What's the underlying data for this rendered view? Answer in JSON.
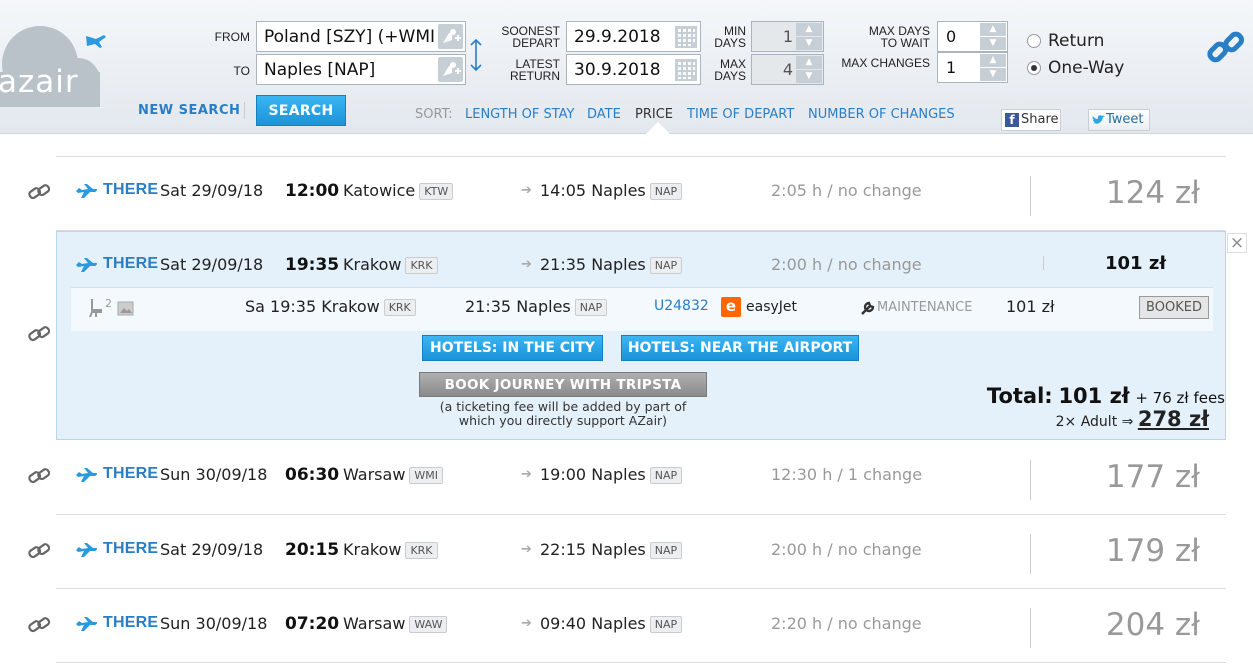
{
  "logo": {
    "text": "azair"
  },
  "search": {
    "from_label": "FROM",
    "to_label": "TO",
    "from_value": "Poland [SZY] (+WMI",
    "to_value": "Naples [NAP]",
    "soonest_depart_label_1": "SOONEST",
    "soonest_depart_label_2": "DEPART",
    "latest_return_label_1": "LATEST",
    "latest_return_label_2": "RETURN",
    "soonest_depart_value": "29.9.2018",
    "latest_return_value": "30.9.2018",
    "min_days_label_1": "MIN",
    "min_days_label_2": "DAYS",
    "max_days_label_1": "MAX",
    "max_days_label_2": "DAYS",
    "min_days_value": "1",
    "max_days_value": "4",
    "max_days_wait_label_1": "MAX DAYS",
    "max_days_wait_label_2": "TO WAIT",
    "max_changes_label": "MAX CHANGES",
    "max_days_wait_value": "0",
    "max_changes_value": "1",
    "return_label": "Return",
    "oneway_label": "One-Way",
    "new_search": "NEW SEARCH",
    "search_button": "SEARCH"
  },
  "sort": {
    "label": "SORT:",
    "items": [
      "LENGTH OF STAY",
      "DATE",
      "PRICE",
      "TIME OF DEPART",
      "NUMBER OF CHANGES"
    ],
    "active": "PRICE"
  },
  "social": {
    "share": "Share",
    "tweet": "Tweet"
  },
  "results": [
    {
      "dir": "THERE",
      "date": "Sat 29/09/18",
      "time": "12:00",
      "city": "Katowice",
      "code": "KTW",
      "arr_time": "14:05",
      "arr_city": "Naples",
      "arr_code": "NAP",
      "duration": "2:05 h / no change",
      "price": "124 zł"
    },
    {
      "dir": "THERE",
      "date": "Sat 29/09/18",
      "time": "19:35",
      "city": "Krakow",
      "code": "KRK",
      "arr_time": "21:35",
      "arr_city": "Naples",
      "arr_code": "NAP",
      "duration": "2:00 h / no change",
      "price": "101 zł"
    },
    {
      "dir": "THERE",
      "date": "Sun 30/09/18",
      "time": "06:30",
      "city": "Warsaw",
      "code": "WMI",
      "arr_time": "19:00",
      "arr_city": "Naples",
      "arr_code": "NAP",
      "duration": "12:30 h / 1 change",
      "price": "177 zł"
    },
    {
      "dir": "THERE",
      "date": "Sat 29/09/18",
      "time": "20:15",
      "city": "Krakow",
      "code": "KRK",
      "arr_time": "22:15",
      "arr_city": "Naples",
      "arr_code": "NAP",
      "duration": "2:00 h / no change",
      "price": "179 zł"
    },
    {
      "dir": "THERE",
      "date": "Sun 30/09/18",
      "time": "07:20",
      "city": "Warsaw",
      "code": "WAW",
      "arr_time": "09:40",
      "arr_city": "Naples",
      "arr_code": "NAP",
      "duration": "2:20 h / no change",
      "price": "204 zł"
    }
  ],
  "detail": {
    "seat_count": "2",
    "dep": "Sa 19:35 Krakow",
    "dep_code": "KRK",
    "arr": "21:35 Naples",
    "arr_code": "NAP",
    "flight_no": "U24832",
    "airline_logo": "e",
    "airline": "easyJet",
    "status": "MAINTENANCE",
    "price": "101 zł",
    "booked": "BOOKED",
    "hotels_city": "HOTELS: IN THE CITY",
    "hotels_airport": "HOTELS: NEAR THE AIRPORT",
    "book_journey": "BOOK JOURNEY WITH TRIPSTA",
    "fee_note_1": "(a ticketing fee will be added by part of",
    "fee_note_2": "which you directly support AZair)",
    "total_label": "Total:",
    "total_price": "101 zł",
    "fees": "+ 76 zł fees",
    "adult_label": "2× Adult ⇒",
    "adult_total": "278 zł",
    "close": "×"
  },
  "colors": {
    "accent": "#2a7ec6",
    "button": "#1a93d9",
    "expanded_bg": "#e4f1fb",
    "easyjet": "#ff6600"
  }
}
